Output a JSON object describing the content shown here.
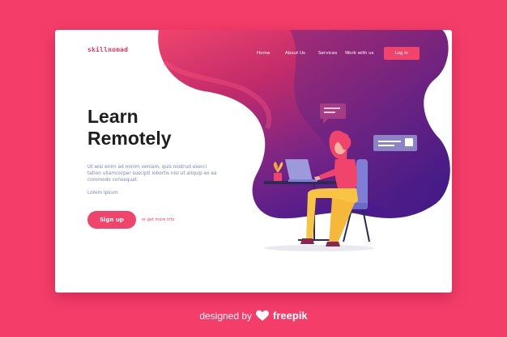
{
  "header": {
    "brand": "skillnomad",
    "nav": [
      "Home",
      "About Us",
      "Services",
      "Work with us"
    ],
    "login_label": "Log in"
  },
  "hero": {
    "title_line1": "Learn",
    "title_line2": "Remotely",
    "body": "Ut wisi enim ad minim veniam, quis nostrud exerci tation ullamcorper suscipit lobortis nisl ut aliquip ex ea commodo consequat.",
    "subtext": "Lorem Ipsum",
    "signup_label": "Sign up",
    "more_link": "or get more info"
  },
  "footer": {
    "designed_by": "designed by",
    "brand": "freepik"
  },
  "colors": {
    "page_bg": "#f53d6a",
    "accent": "#f0446d",
    "gradient_top": "#f0446d",
    "gradient_bottom": "#4a1a8c"
  }
}
